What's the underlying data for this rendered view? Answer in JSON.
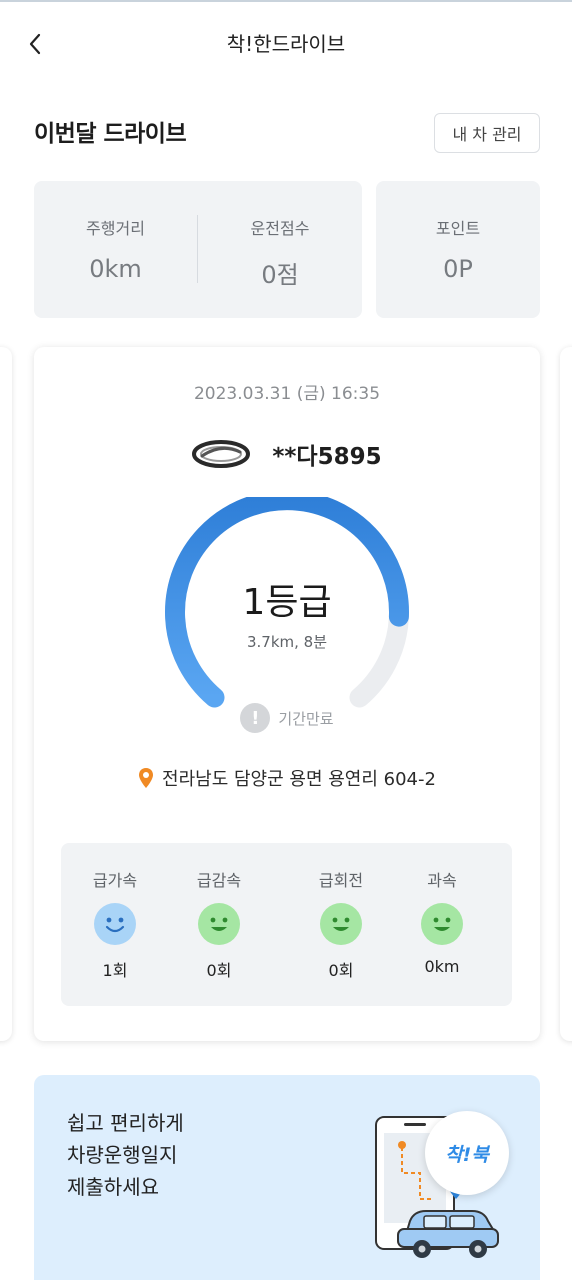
{
  "header": {
    "title": "착!한드라이브",
    "back_icon": "chevron-left-icon"
  },
  "monthly": {
    "title": "이번달 드라이브",
    "manage_button": "내 차 관리",
    "stats": [
      {
        "label": "주행거리",
        "value": "0km"
      },
      {
        "label": "운전점수",
        "value": "0점"
      },
      {
        "label": "포인트",
        "value": "0P"
      }
    ]
  },
  "drive": {
    "datetime": "2023.03.31 (금) 16:35",
    "brand_icon": "car-brand-logo-icon",
    "plate": "**다5895",
    "grade": "1등급",
    "summary": "3.7km, 8분",
    "gauge_level": 0.83,
    "gauge_color": "#3a8be0",
    "status": "기간만료",
    "location_icon": "location-pin-icon",
    "location": "전라남도 담양군 용면 용연리 604-2",
    "events": [
      {
        "label": "급가속",
        "value": "1회",
        "face": "smile-face-icon",
        "color": "#a9d4f7"
      },
      {
        "label": "급감속",
        "value": "0회",
        "face": "smile-face-icon",
        "color": "#a5e6a3"
      },
      {
        "label": "급회전",
        "value": "0회",
        "face": "smile-face-icon",
        "color": "#a5e6a3"
      },
      {
        "label": "과속",
        "value": "0km",
        "face": "smile-face-icon",
        "color": "#a5e6a3"
      }
    ]
  },
  "promo": {
    "lines": [
      "쉽고 편리하게",
      "차량운행일지",
      "제출하세요"
    ],
    "badge": "착!북",
    "illustration": "phone-map-car-icon"
  }
}
